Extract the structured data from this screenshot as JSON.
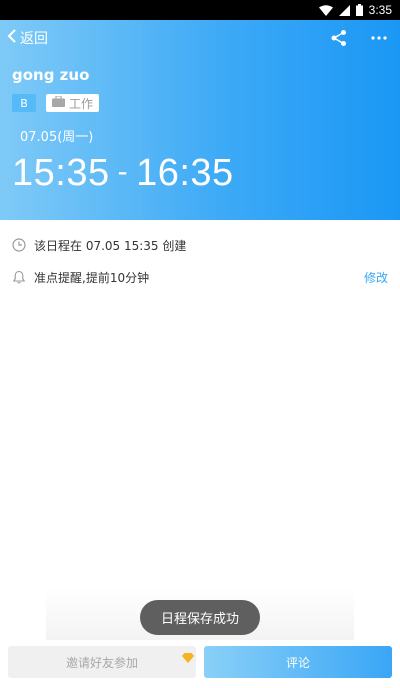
{
  "status_bar": {
    "time": "3:35"
  },
  "header": {
    "back_label": "返回",
    "title": "gong zuo",
    "badge_letter": "B",
    "category_label": "工作",
    "date": "07.05(周一)",
    "start_time": "15:35",
    "separator": "-",
    "end_time": "16:35"
  },
  "info": {
    "created_text": "该日程在 07.05 15:35 创建",
    "reminder_text": "准点提醒,提前10分钟",
    "edit_label": "修改"
  },
  "toast": {
    "message": "日程保存成功"
  },
  "bottom_bar": {
    "invite_label": "邀请好友参加",
    "comment_label": "评论"
  },
  "colors": {
    "accent": "#39a6f5",
    "header_gradient_start": "#7fcaf7",
    "header_gradient_end": "#1a97f5"
  }
}
